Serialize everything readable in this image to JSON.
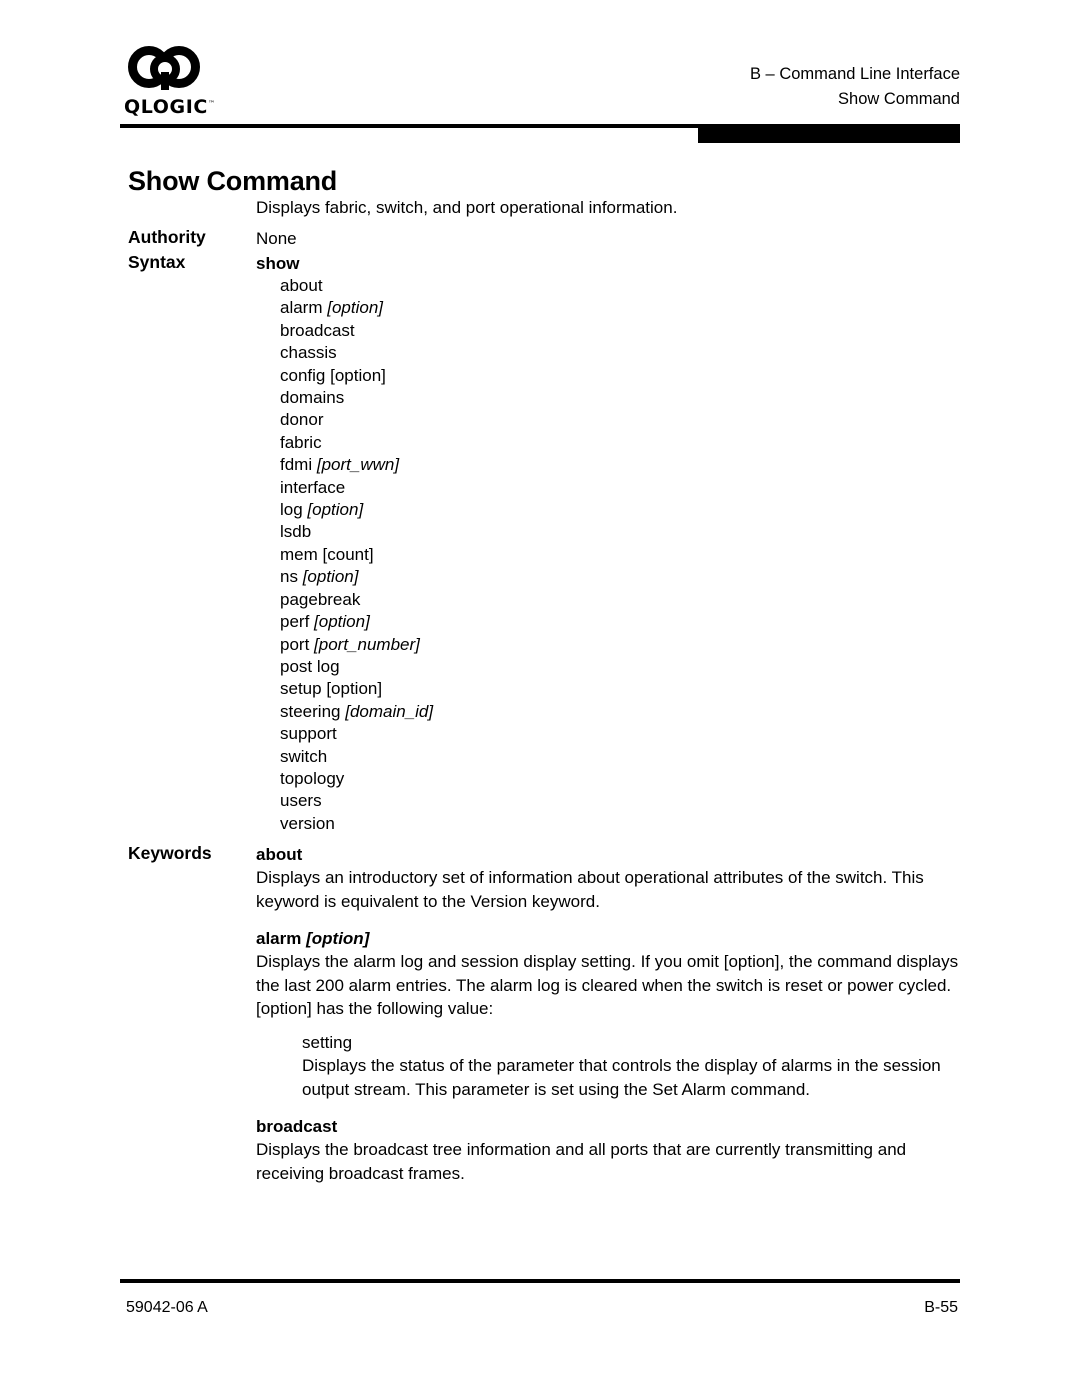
{
  "header": {
    "logo_word": "QLOGIC",
    "logo_tm": "™",
    "line1": "B – Command Line Interface",
    "line2": "Show Command"
  },
  "title": "Show Command",
  "intro": "Displays fabric, switch, and port operational information.",
  "labels": {
    "authority": "Authority",
    "syntax": "Syntax",
    "keywords": "Keywords"
  },
  "authority_value": "None",
  "syntax": {
    "command": "show",
    "items": [
      {
        "name": "about",
        "arg": "",
        "italic": false
      },
      {
        "name": "alarm",
        "arg": "[option]",
        "italic": true
      },
      {
        "name": "broadcast",
        "arg": "",
        "italic": false
      },
      {
        "name": "chassis",
        "arg": "",
        "italic": false
      },
      {
        "name": "config",
        "arg": "[option]",
        "italic": false
      },
      {
        "name": "domains",
        "arg": "",
        "italic": false
      },
      {
        "name": "donor",
        "arg": "",
        "italic": false
      },
      {
        "name": "fabric",
        "arg": "",
        "italic": false
      },
      {
        "name": "fdmi",
        "arg": "[port_wwn]",
        "italic": true
      },
      {
        "name": "interface",
        "arg": "",
        "italic": false
      },
      {
        "name": "log",
        "arg": "[option]",
        "italic": true
      },
      {
        "name": "lsdb",
        "arg": "",
        "italic": false
      },
      {
        "name": "mem",
        "arg": "[count]",
        "italic": false
      },
      {
        "name": "ns",
        "arg": "[option]",
        "italic": true
      },
      {
        "name": "pagebreak",
        "arg": "",
        "italic": false
      },
      {
        "name": "perf",
        "arg": "[option]",
        "italic": true
      },
      {
        "name": "port",
        "arg": "[port_number]",
        "italic": true
      },
      {
        "name": "post log",
        "arg": "",
        "italic": false
      },
      {
        "name": "setup",
        "arg": "[option]",
        "italic": false
      },
      {
        "name": "steering",
        "arg": "[domain_id]",
        "italic": true
      },
      {
        "name": "support",
        "arg": "",
        "italic": false
      },
      {
        "name": "switch",
        "arg": "",
        "italic": false
      },
      {
        "name": "topology",
        "arg": "",
        "italic": false
      },
      {
        "name": "users",
        "arg": "",
        "italic": false
      },
      {
        "name": "version",
        "arg": "",
        "italic": false
      }
    ]
  },
  "keywords": [
    {
      "name": "about",
      "arg": "",
      "italic": false,
      "body": "Displays an introductory set of information about operational attributes of the switch. This keyword is equivalent to the Version keyword.",
      "sub": null
    },
    {
      "name": "alarm",
      "arg": "[option]",
      "italic": true,
      "body": "Displays the alarm log and session display setting. If you omit [option], the command displays the last 200 alarm entries. The alarm log is cleared when the switch is reset or power cycled. [option] has the following value:",
      "sub": {
        "name": "setting",
        "body": "Displays the status of the parameter that controls the display of alarms in the session output stream. This parameter is set using the Set Alarm command."
      }
    },
    {
      "name": "broadcast",
      "arg": "",
      "italic": false,
      "body": "Displays the broadcast tree information and all ports that are currently transmitting and receiving broadcast frames.",
      "sub": null
    }
  ],
  "footer": {
    "doc_number": "59042-06 A",
    "page_number": "B-55"
  }
}
